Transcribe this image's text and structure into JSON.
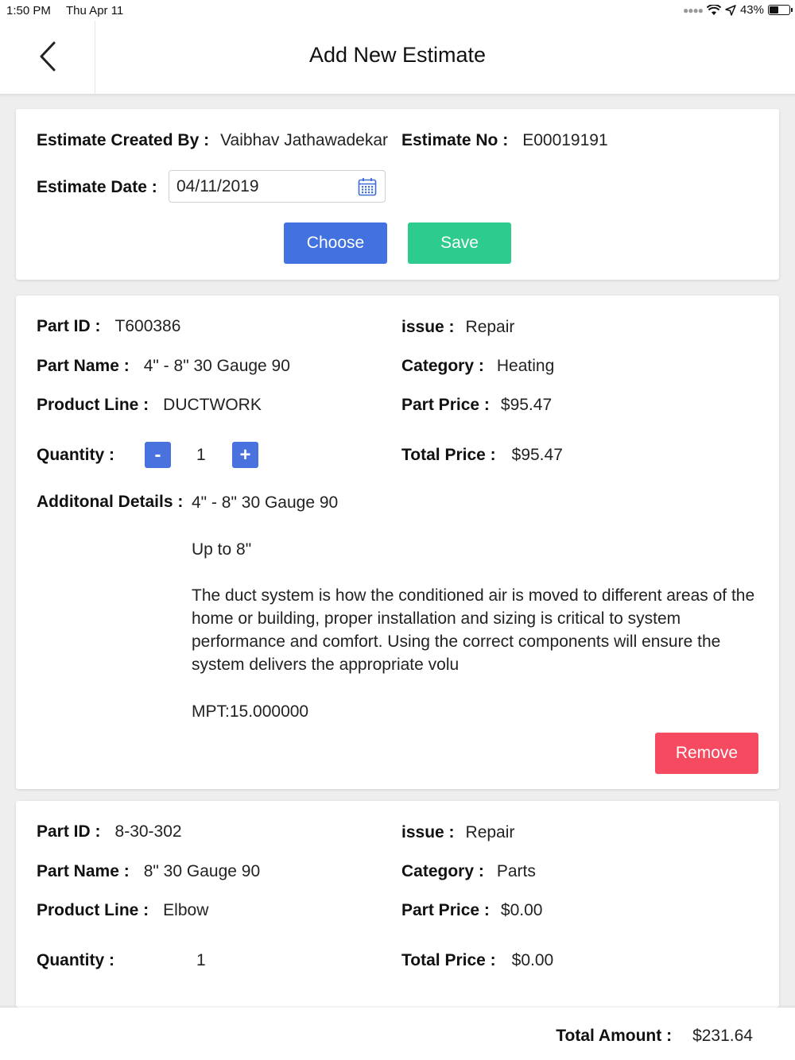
{
  "status_bar": {
    "time": "1:50 PM",
    "date": "Thu Apr 11",
    "battery": "43%",
    "battery_level": 0.43
  },
  "nav": {
    "title": "Add New Estimate"
  },
  "estimate": {
    "created_by_label": "Estimate Created By :",
    "created_by_value": "Vaibhav Jathawadekar",
    "number_label": "Estimate No :",
    "number_value": "E00019191",
    "date_label": "Estimate Date :",
    "date_value": "04/11/2019",
    "choose_label": "Choose",
    "save_label": "Save"
  },
  "items": [
    {
      "part_id_label": "Part ID :",
      "part_id": "T600386",
      "part_name_label": "Part Name :",
      "part_name": "4\" - 8\" 30 Gauge 90",
      "product_line_label": "Product Line :",
      "product_line": "DUCTWORK",
      "quantity_label": "Quantity :",
      "quantity": "1",
      "issue_label": "issue :",
      "issue": "Repair",
      "category_label": "Category :",
      "category": "Heating",
      "part_price_label": "Part Price :",
      "part_price": "$95.47",
      "total_price_label": "Total Price :",
      "total_price": "$95.47",
      "details_label": "Additonal Details :",
      "details_line1": "4\" - 8\" 30 Gauge 90",
      "details_line2": "Up to 8\"",
      "details_line3": "The duct system is how the conditioned air is moved to different areas of the home or building, proper installation and sizing is critical to system performance and comfort. Using the correct components will ensure the system delivers the appropriate volu",
      "details_line4": "MPT:15.000000",
      "minus_label": "-",
      "plus_label": "+",
      "remove_label": "Remove"
    },
    {
      "part_id_label": "Part ID :",
      "part_id": "8-30-302",
      "part_name_label": "Part Name :",
      "part_name": "8\" 30 Gauge 90",
      "product_line_label": "Product Line :",
      "product_line": "Elbow",
      "quantity_label": "Quantity :",
      "quantity": "1",
      "issue_label": "issue :",
      "issue": "Repair",
      "category_label": "Category :",
      "category": "Parts",
      "part_price_label": "Part Price :",
      "part_price": "$0.00",
      "total_price_label": "Total Price :",
      "total_price": "$0.00"
    }
  ],
  "footer": {
    "total_label": "Total Amount :",
    "total_value": "$231.64"
  },
  "colors": {
    "choose": "#4272e0",
    "save": "#2ecb8f",
    "remove": "#f64a60",
    "stepper": "#4a72df"
  }
}
